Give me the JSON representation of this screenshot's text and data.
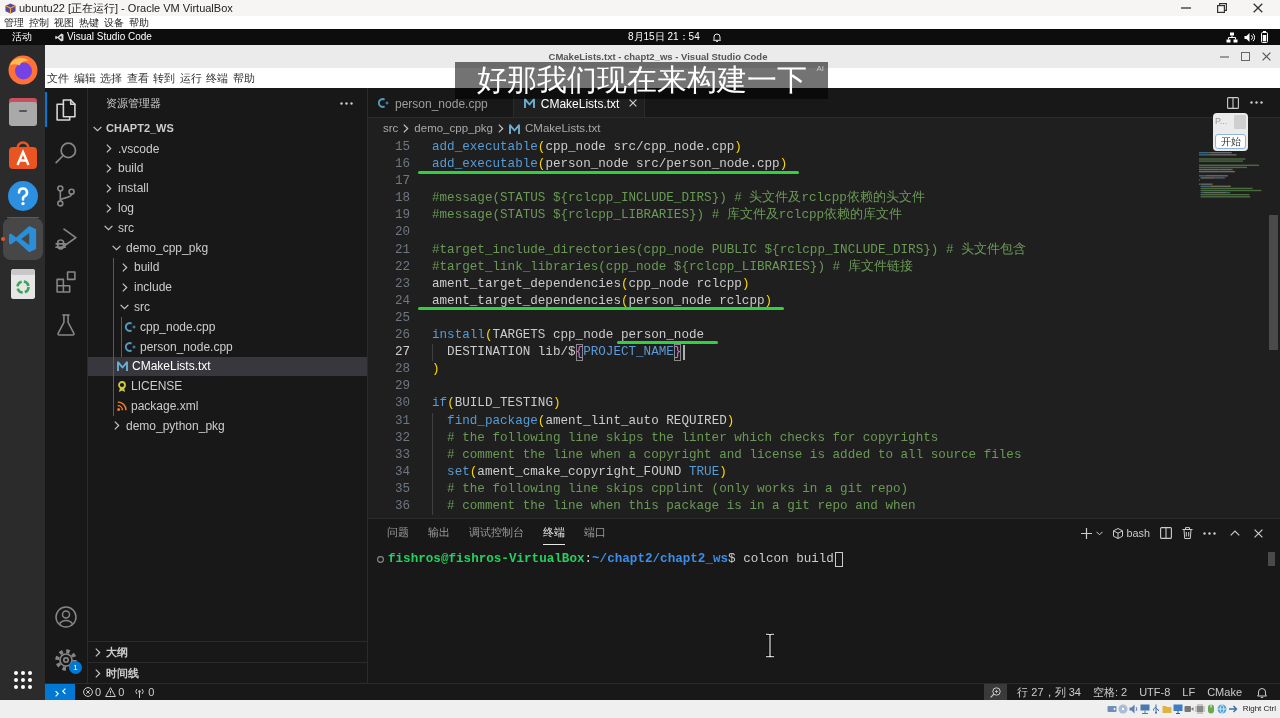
{
  "vm_window": {
    "title": "ubuntu22 [正在运行] - Oracle VM VirtualBox",
    "menu": [
      "管理",
      "控制",
      "视图",
      "热键",
      "设备",
      "帮助"
    ],
    "host_key": "Right Ctrl"
  },
  "top_bar": {
    "activities": "活动",
    "app": "Visual Studio Code",
    "clock": "8月15日 21：54"
  },
  "dock": {
    "favorites": [
      {
        "kind": "browser",
        "selected": false
      },
      {
        "kind": "files",
        "selected": false
      },
      {
        "kind": "software",
        "selected": false
      },
      {
        "kind": "help",
        "selected": false
      }
    ],
    "others": [
      {
        "kind": "code",
        "selected": true
      },
      {
        "kind": "trash",
        "selected": false
      }
    ]
  },
  "subtitle": {
    "text": "好那我们现在来构建一下",
    "badge": "AI"
  },
  "vscode": {
    "title": "CMakeLists.txt - chapt2_ws - Visual Studio Code",
    "menu": [
      "文件",
      "编辑",
      "选择",
      "查看",
      "转到",
      "运行",
      "终端",
      "帮助"
    ],
    "activity_bar": {
      "items": [
        {
          "kind": "explorer",
          "selected": true
        },
        {
          "kind": "search",
          "selected": false
        },
        {
          "kind": "source_control",
          "selected": false
        },
        {
          "kind": "run_debug",
          "selected": false
        },
        {
          "kind": "extensions",
          "selected": false
        },
        {
          "kind": "testing",
          "selected": false
        }
      ],
      "manage_badge": "1"
    },
    "sidebar": {
      "title": "资源管理器",
      "tree": {
        "label": "CHAPT2_WS",
        "kind": "folder",
        "expanded": true,
        "selected": false,
        "children": [
          {
            "label": ".vscode",
            "kind": "folder",
            "expanded": false,
            "selected": false
          },
          {
            "label": "build",
            "kind": "folder",
            "expanded": false,
            "selected": false
          },
          {
            "label": "install",
            "kind": "folder",
            "expanded": false,
            "selected": false
          },
          {
            "label": "log",
            "kind": "folder",
            "expanded": false,
            "selected": false
          },
          {
            "label": "src",
            "kind": "folder",
            "expanded": true,
            "selected": false,
            "children": [
              {
                "label": "demo_cpp_pkg",
                "kind": "folder",
                "expanded": true,
                "selected": false,
                "children": [
                  {
                    "label": "build",
                    "kind": "folder",
                    "expanded": false,
                    "selected": false
                  },
                  {
                    "label": "include",
                    "kind": "folder",
                    "expanded": false,
                    "selected": false
                  },
                  {
                    "label": "src",
                    "kind": "folder",
                    "expanded": true,
                    "selected": false,
                    "children": [
                      {
                        "label": "cpp_node.cpp",
                        "kind": "cpp",
                        "selected": false
                      },
                      {
                        "label": "person_node.cpp",
                        "kind": "cpp",
                        "selected": false
                      }
                    ]
                  },
                  {
                    "label": "CMakeLists.txt",
                    "kind": "cmake",
                    "selected": true
                  },
                  {
                    "label": "LICENSE",
                    "kind": "license",
                    "selected": false
                  },
                  {
                    "label": "package.xml",
                    "kind": "xml",
                    "selected": false
                  }
                ]
              },
              {
                "label": "demo_python_pkg",
                "kind": "folder",
                "expanded": false,
                "selected": false
              }
            ]
          }
        ]
      },
      "sections": [
        {
          "label": "大纲",
          "expanded": false
        },
        {
          "label": "时间线",
          "expanded": false
        }
      ]
    },
    "editor": {
      "tabs": [
        {
          "label": "person_node.cpp",
          "kind": "cpp",
          "selected": false
        },
        {
          "label": "CMakeLists.txt",
          "kind": "cmake",
          "selected": true
        }
      ],
      "breadcrumb": [
        {
          "label": "src",
          "kind": "folder"
        },
        {
          "label": "demo_cpp_pkg",
          "kind": "folder"
        },
        {
          "label": "CMakeLists.txt",
          "kind": "cmake"
        }
      ],
      "lines": [
        {
          "number": "15",
          "current": false,
          "underlined": false,
          "tokens": [
            {
              "kind": "command",
              "text": "add_executable"
            },
            {
              "kind": "bracket",
              "text": "("
            },
            {
              "kind": "plain",
              "text": "cpp_node src/cpp_node.cpp"
            },
            {
              "kind": "bracket",
              "text": ")"
            }
          ]
        },
        {
          "number": "16",
          "current": false,
          "underlined": true,
          "tokens": [
            {
              "kind": "command",
              "text": "add_executable"
            },
            {
              "kind": "bracket",
              "text": "("
            },
            {
              "kind": "plain",
              "text": "person_node src/person_node.cpp"
            },
            {
              "kind": "bracket",
              "text": ")"
            }
          ]
        },
        {
          "number": "17",
          "current": false
        },
        {
          "number": "18",
          "current": false,
          "underlined": false,
          "tokens": [
            {
              "kind": "comment",
              "text": "#message(STATUS ${rclcpp_INCLUDE_DIRS}) # 头文件及rclcpp依赖的头文件"
            }
          ]
        },
        {
          "number": "19",
          "current": false,
          "underlined": false,
          "tokens": [
            {
              "kind": "comment",
              "text": "#message(STATUS ${rclcpp_LIBRARIES}) # 库文件及rclcpp依赖的库文件"
            }
          ]
        },
        {
          "number": "20",
          "current": false
        },
        {
          "number": "21",
          "current": false,
          "underlined": false,
          "tokens": [
            {
              "kind": "comment",
              "text": "#target_include_directories(cpp_node PUBLIC ${rclcpp_INCLUDE_DIRS}) # 头文件包含"
            }
          ]
        },
        {
          "number": "22",
          "current": false,
          "underlined": false,
          "tokens": [
            {
              "kind": "comment",
              "text": "#target_link_libraries(cpp_node ${rclcpp_LIBRARIES}) # 库文件链接"
            }
          ]
        },
        {
          "number": "23",
          "current": false,
          "underlined": false,
          "tokens": [
            {
              "kind": "plain",
              "text": "ament_target_dependencies"
            },
            {
              "kind": "bracket",
              "text": "("
            },
            {
              "kind": "plain",
              "text": "cpp_node rclcpp"
            },
            {
              "kind": "bracket",
              "text": ")"
            }
          ]
        },
        {
          "number": "24",
          "current": false,
          "underlined": true,
          "tokens": [
            {
              "kind": "plain",
              "text": "ament_target_dependencies"
            },
            {
              "kind": "bracket",
              "text": "("
            },
            {
              "kind": "plain",
              "text": "person_node rclcpp"
            },
            {
              "kind": "bracket",
              "text": ")"
            }
          ]
        },
        {
          "number": "25",
          "current": false
        },
        {
          "number": "26",
          "current": false,
          "tokens": [
            {
              "kind": "command",
              "text": "install",
              "underlined": false
            },
            {
              "kind": "bracket",
              "text": "(",
              "underlined": false
            },
            {
              "kind": "plain",
              "text": "TARGETS cpp_node ",
              "underlined": false
            },
            {
              "kind": "plain",
              "text": "person_node",
              "underlined": true
            }
          ],
          "children": [
            {
              "number": "27",
              "current": true,
              "underlined": false,
              "tokens": [
                {
                  "kind": "plain",
                  "text": "DESTINATION lib/$"
                },
                {
                  "kind": "bracket_match",
                  "text": "{"
                },
                {
                  "kind": "variable",
                  "text": "PROJECT_NAME"
                },
                {
                  "kind": "bracket_match",
                  "text": "}"
                }
              ]
            }
          ]
        },
        {
          "number": "28",
          "current": false,
          "underlined": false,
          "tokens": [
            {
              "kind": "bracket",
              "text": ")"
            }
          ]
        },
        {
          "number": "29",
          "current": false
        },
        {
          "number": "30",
          "current": false,
          "underlined": false,
          "tokens": [
            {
              "kind": "command",
              "text": "if"
            },
            {
              "kind": "bracket",
              "text": "("
            },
            {
              "kind": "plain",
              "text": "BUILD_TESTING"
            },
            {
              "kind": "bracket",
              "text": ")"
            }
          ],
          "children": [
            {
              "number": "31",
              "current": false,
              "underlined": false,
              "tokens": [
                {
                  "kind": "command",
                  "text": "find_package"
                },
                {
                  "kind": "bracket",
                  "text": "("
                },
                {
                  "kind": "plain",
                  "text": "ament_lint_auto REQUIRED"
                },
                {
                  "kind": "bracket",
                  "text": ")"
                }
              ]
            },
            {
              "number": "32",
              "current": false,
              "underlined": false,
              "tokens": [
                {
                  "kind": "comment",
                  "text": "# the following line skips the linter which checks for copyrights"
                }
              ]
            },
            {
              "number": "33",
              "current": false,
              "underlined": false,
              "tokens": [
                {
                  "kind": "comment",
                  "text": "# comment the line when a copyright and license is added to all source files"
                }
              ]
            },
            {
              "number": "34",
              "current": false,
              "underlined": false,
              "tokens": [
                {
                  "kind": "command",
                  "text": "set"
                },
                {
                  "kind": "bracket",
                  "text": "("
                },
                {
                  "kind": "plain",
                  "text": "ament_cmake_copyright_FOUND "
                },
                {
                  "kind": "constant",
                  "text": "TRUE"
                },
                {
                  "kind": "bracket",
                  "text": ")"
                }
              ]
            },
            {
              "number": "35",
              "current": false,
              "underlined": false,
              "tokens": [
                {
                  "kind": "comment",
                  "text": "# the following line skips cpplint (only works in a git repo)"
                }
              ]
            },
            {
              "number": "36",
              "current": false,
              "underlined": false,
              "tokens": [
                {
                  "kind": "comment",
                  "text": "# comment the line when this package is in a git repo and when"
                }
              ]
            }
          ]
        }
      ],
      "overlay": {
        "label": "P...",
        "button": "开始"
      }
    },
    "panel": {
      "tabs": [
        {
          "label": "问题",
          "selected": false
        },
        {
          "label": "输出",
          "selected": false
        },
        {
          "label": "调试控制台",
          "selected": false
        },
        {
          "label": "终端",
          "selected": true
        },
        {
          "label": "端口",
          "selected": false
        }
      ],
      "shell": "bash",
      "terminal": [
        {
          "kind": "user",
          "text": "fishros@fishros-VirtualBox"
        },
        {
          "kind": "plain",
          "text": ":"
        },
        {
          "kind": "path",
          "text": "~/chapt2/chapt2_ws"
        },
        {
          "kind": "plain",
          "text": "$ colcon build"
        }
      ]
    },
    "status_bar": {
      "errors": "0",
      "warnings": "0",
      "ports": "0",
      "zoom_highlighted": true,
      "items": [
        "行 27，列 34",
        "空格: 2",
        "UTF-8",
        "LF",
        "CMake"
      ]
    }
  }
}
